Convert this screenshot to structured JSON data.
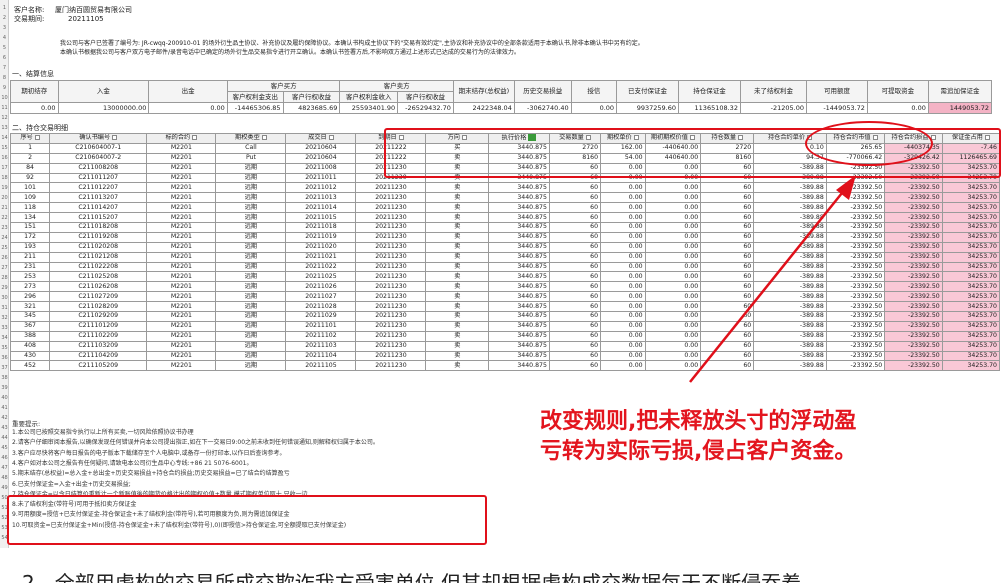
{
  "header": {
    "customer_label": "客户名称:",
    "customer_name": "厦门纳百圆贸易有限公司",
    "period_label": "交易期间:",
    "period": "20211105"
  },
  "intro": "我公司与客户已签署了编号为: JR-cwqq-200910-01 的场外衍生品主协议、补充协议及履约保障协议。本确认书构成主协议下的\"交易有效约定\",主协议和补充协议中的全部条款适用于本确认书,除非本确认书中另有约定。",
  "intro2": "本确认书根据我公司与客户双方电子邮件/录音电话中已确定的场外衍生品交易指令进行开立确认。本确认书签署方后,不影响双方通过上述形式已达成的交易行为的法律效力。",
  "section1": {
    "title": "一、结算信息",
    "group_customer_buy": "客户买方",
    "group_customer_sell": "客户卖方",
    "headers": [
      "期初结存",
      "入金",
      "出金",
      "客户权利金支出",
      "客户行权收益",
      "客户权利金收入",
      "客户行权收益",
      "期末结存(总权益)",
      "历史交易损益",
      "授信",
      "已支付保证金",
      "持仓保证金",
      "未了结权利金",
      "可用额度",
      "可提取资金",
      "需追加保证金"
    ],
    "values": [
      "0.00",
      "13000000.00",
      "0.00",
      "-14465306.85",
      "4823685.69",
      "25593401.90",
      "-26529432.70",
      "2422348.04",
      "-3062740.40",
      "0.00",
      "9937259.60",
      "11365108.32",
      "-21205.00",
      "-1449053.72",
      "0.00",
      "1449053.72"
    ]
  },
  "section2": {
    "title": "二、持仓交易明细",
    "headers": [
      "序号",
      "确认书编号",
      "标的合约",
      "期权类型",
      "成交日",
      "到期日",
      "方向",
      "执行价格",
      "交易数量",
      "期权单价",
      "期初期权价值",
      "持仓数量",
      "持仓合约单价",
      "持仓合约市值",
      "持仓合约损益",
      "保证金占用"
    ],
    "rows": [
      [
        "1",
        "C210604007-1",
        "M2201",
        "Call",
        "20210604",
        "20211222",
        "买",
        "3440.875",
        "2720",
        "162.00",
        "-440640.00",
        "2720",
        "0.10",
        "265.65",
        "-440374.35",
        "-7.46"
      ],
      [
        "2",
        "C210604007-2",
        "M2201",
        "Put",
        "20210604",
        "20211222",
        "卖",
        "3440.875",
        "8160",
        "54.00",
        "440640.00",
        "8160",
        "94.37",
        "-770066.42",
        "-329426.42",
        "1126465.69"
      ],
      [
        "84",
        "C211008208",
        "M2201",
        "远期",
        "20211008",
        "20211230",
        "卖",
        "3440.875",
        "60",
        "0.00",
        "0.00",
        "60",
        "-389.88",
        "-23392.50",
        "-23392.50",
        "34253.70"
      ],
      [
        "92",
        "C211011207",
        "M2201",
        "远期",
        "20211011",
        "20211230",
        "卖",
        "3440.875",
        "60",
        "0.00",
        "0.00",
        "60",
        "-389.88",
        "-23392.50",
        "-23392.50",
        "34253.70"
      ],
      [
        "101",
        "C211012207",
        "M2201",
        "远期",
        "20211012",
        "20211230",
        "卖",
        "3440.875",
        "60",
        "0.00",
        "0.00",
        "60",
        "-389.88",
        "-23392.50",
        "-23392.50",
        "34253.70"
      ],
      [
        "109",
        "C211013207",
        "M2201",
        "远期",
        "20211013",
        "20211230",
        "卖",
        "3440.875",
        "60",
        "0.00",
        "0.00",
        "60",
        "-389.88",
        "-23392.50",
        "-23392.50",
        "34253.70"
      ],
      [
        "118",
        "C211014207",
        "M2201",
        "远期",
        "20211014",
        "20211230",
        "卖",
        "3440.875",
        "60",
        "0.00",
        "0.00",
        "60",
        "-389.88",
        "-23392.50",
        "-23392.50",
        "34253.70"
      ],
      [
        "134",
        "C211015207",
        "M2201",
        "远期",
        "20211015",
        "20211230",
        "卖",
        "3440.875",
        "60",
        "0.00",
        "0.00",
        "60",
        "-389.88",
        "-23392.50",
        "-23392.50",
        "34253.70"
      ],
      [
        "151",
        "C211018208",
        "M2201",
        "远期",
        "20211018",
        "20211230",
        "卖",
        "3440.875",
        "60",
        "0.00",
        "0.00",
        "60",
        "-389.88",
        "-23392.50",
        "-23392.50",
        "34253.70"
      ],
      [
        "172",
        "C211019208",
        "M2201",
        "远期",
        "20211019",
        "20211230",
        "卖",
        "3440.875",
        "60",
        "0.00",
        "0.00",
        "60",
        "-389.88",
        "-23392.50",
        "-23392.50",
        "34253.70"
      ],
      [
        "193",
        "C211020208",
        "M2201",
        "远期",
        "20211020",
        "20211230",
        "卖",
        "3440.875",
        "60",
        "0.00",
        "0.00",
        "60",
        "-389.88",
        "-23392.50",
        "-23392.50",
        "34253.70"
      ],
      [
        "211",
        "C211021208",
        "M2201",
        "远期",
        "20211021",
        "20211230",
        "卖",
        "3440.875",
        "60",
        "0.00",
        "0.00",
        "60",
        "-389.88",
        "-23392.50",
        "-23392.50",
        "34253.70"
      ],
      [
        "231",
        "C211022208",
        "M2201",
        "远期",
        "20211022",
        "20211230",
        "卖",
        "3440.875",
        "60",
        "0.00",
        "0.00",
        "60",
        "-389.88",
        "-23392.50",
        "-23392.50",
        "34253.70"
      ],
      [
        "253",
        "C211025208",
        "M2201",
        "远期",
        "20211025",
        "20211230",
        "卖",
        "3440.875",
        "60",
        "0.00",
        "0.00",
        "60",
        "-389.88",
        "-23392.50",
        "-23392.50",
        "34253.70"
      ],
      [
        "273",
        "C211026208",
        "M2201",
        "远期",
        "20211026",
        "20211230",
        "卖",
        "3440.875",
        "60",
        "0.00",
        "0.00",
        "60",
        "-389.88",
        "-23392.50",
        "-23392.50",
        "34253.70"
      ],
      [
        "296",
        "C211027209",
        "M2201",
        "远期",
        "20211027",
        "20211230",
        "卖",
        "3440.875",
        "60",
        "0.00",
        "0.00",
        "60",
        "-389.88",
        "-23392.50",
        "-23392.50",
        "34253.70"
      ],
      [
        "321",
        "C211028209",
        "M2201",
        "远期",
        "20211028",
        "20211230",
        "卖",
        "3440.875",
        "60",
        "0.00",
        "0.00",
        "60",
        "-389.88",
        "-23392.50",
        "-23392.50",
        "34253.70"
      ],
      [
        "345",
        "C211029209",
        "M2201",
        "远期",
        "20211029",
        "20211230",
        "卖",
        "3440.875",
        "60",
        "0.00",
        "0.00",
        "60",
        "-389.88",
        "-23392.50",
        "-23392.50",
        "34253.70"
      ],
      [
        "367",
        "C211101209",
        "M2201",
        "远期",
        "20211101",
        "20211230",
        "卖",
        "3440.875",
        "60",
        "0.00",
        "0.00",
        "60",
        "-389.88",
        "-23392.50",
        "-23392.50",
        "34253.70"
      ],
      [
        "388",
        "C211102209",
        "M2201",
        "远期",
        "20211102",
        "20211230",
        "卖",
        "3440.875",
        "60",
        "0.00",
        "0.00",
        "60",
        "-389.88",
        "-23392.50",
        "-23392.50",
        "34253.70"
      ],
      [
        "408",
        "C211103209",
        "M2201",
        "远期",
        "20211103",
        "20211230",
        "卖",
        "3440.875",
        "60",
        "0.00",
        "0.00",
        "60",
        "-389.88",
        "-23392.50",
        "-23392.50",
        "34253.70"
      ],
      [
        "430",
        "C211104209",
        "M2201",
        "远期",
        "20211104",
        "20211230",
        "卖",
        "3440.875",
        "60",
        "0.00",
        "0.00",
        "60",
        "-389.88",
        "-23392.50",
        "-23392.50",
        "34253.70"
      ],
      [
        "452",
        "C211105209",
        "M2201",
        "远期",
        "20211105",
        "20211230",
        "卖",
        "3440.875",
        "60",
        "0.00",
        "0.00",
        "60",
        "-389.88",
        "-23392.50",
        "-23392.50",
        "34253.70"
      ]
    ]
  },
  "notes": {
    "title": "重要提示:",
    "lines": [
      "1.本公司已按照交易指令执行以上所有买卖,一切风险依照协议书办理",
      "2.请客户仔细审阅本报告,以确保发现任何错误并向本公司提出指正,如在下一交易日9:00之前未收到任何错误通知,则解释权归属于本公司。",
      "3.客户应尽快将客户每日报告的电子版本下载储存至个人电脑中,或备存一份打印本,以作日后查询参考。",
      "4.客户如对本公司之报告有任何疑问,请致电本公司衍生品中心专线:+86 21 5076-6001。",
      "5.期末结存(总权益)=总入金+总出金+历史交易损益+持仓合约损益;历史交易损益=已了结合约结算盈亏",
      "6.已支付保证金=入金+出金+历史交易损益;",
      "7.持仓保证金=以今日结算价重新计一个新账值後的期货价格计出的期权价值+数量,模式期权单位取十,只收一边",
      "8.未了结权利金(带符号)可用于抵扣卖方保证金",
      "9.可用额度=授信+已支付保证金-持仓保证金+未了结权利金(带符号),若可用额度为负,则为需追加保证金",
      "10.可取资金=已支付保证金+Min(授信-持仓保证金+未了结权利金(带符号),0)(即授信>持仓保证金,可全额提取已支付保证金)"
    ]
  },
  "annotation": {
    "line1": "改变规则,把未释放头寸的浮动盈",
    "line2": "亏转为实际亏损,侵占客户资金。"
  },
  "bottom_caption": "2、全部用虚构的交易所成交欺诈我方受害单位,但其却根据虚构成交数据每天不断侵吞着"
}
